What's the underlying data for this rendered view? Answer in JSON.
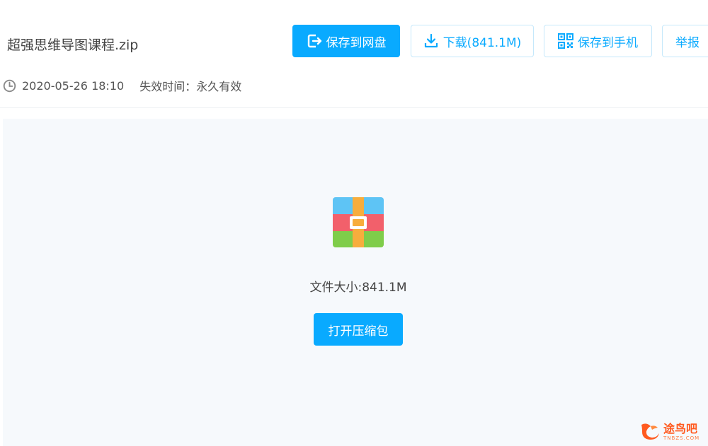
{
  "file": {
    "name": "超强思维导图课程.zip",
    "date": "2020-05-26 18:10",
    "expire_label": "失效时间：",
    "expire_value": "永久有效"
  },
  "toolbar": {
    "save_label": "保存到网盘",
    "download_label": "下载(841.1M)",
    "phone_label": "保存到手机",
    "report_label": "举报"
  },
  "preview": {
    "size_text": "文件大小:841.1M",
    "open_label": "打开压缩包"
  },
  "watermark": {
    "main": "途鸟吧",
    "sub": "TNBZS.COM"
  },
  "colors": {
    "accent": "#09aaff",
    "preview_bg": "#f6f9fc"
  },
  "icons": {
    "save": "export-to-cloud-icon",
    "download": "download-icon",
    "phone": "qr-code-icon",
    "clock": "clock-icon",
    "file": "zip-archive-icon"
  }
}
